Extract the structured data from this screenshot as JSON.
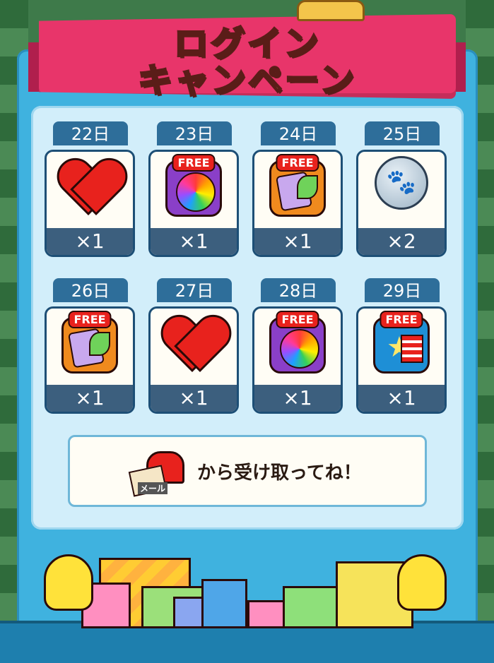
{
  "title": {
    "line1": "ログイン",
    "line2": "キャンペーン"
  },
  "rewards": [
    {
      "day": "22日",
      "icon": "heart-icon",
      "free": "",
      "qty": "×1"
    },
    {
      "day": "23日",
      "icon": "rainbow-candy-icon",
      "free": "FREE",
      "qty": "×1"
    },
    {
      "day": "24日",
      "icon": "candy-pack-icon",
      "free": "FREE",
      "qty": "×1"
    },
    {
      "day": "25日",
      "icon": "paw-coin-icon",
      "free": "",
      "qty": "×2"
    },
    {
      "day": "26日",
      "icon": "candy-pack-icon",
      "free": "FREE",
      "qty": "×1"
    },
    {
      "day": "27日",
      "icon": "heart-icon",
      "free": "",
      "qty": "×1"
    },
    {
      "day": "28日",
      "icon": "rainbow-candy-icon",
      "free": "FREE",
      "qty": "×1"
    },
    {
      "day": "29日",
      "icon": "star-candy-icon",
      "free": "FREE",
      "qty": "×1"
    }
  ],
  "mail": {
    "icon_label": "メール",
    "text": "から受け取ってね！"
  },
  "colors": {
    "banner": "#e8356a",
    "frame": "#3fb2df",
    "panel": "#d2eefa",
    "day_label": "#2e6e9a",
    "qty_bar": "#3c5f7e"
  }
}
